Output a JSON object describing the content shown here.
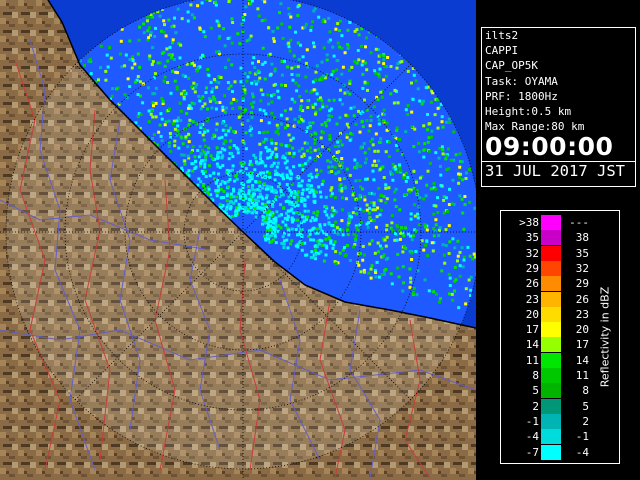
{
  "info_panel": {
    "lines": [
      "ilts2",
      "CAPPI",
      "CAP_OP5K",
      "Task: OYAMA",
      "PRF: 1800Hz",
      "Height:0.5 km",
      "Max Range:80 km"
    ],
    "time": "09:00:00",
    "date": "31 JUL 2017 JST"
  },
  "legend": {
    "title": "Reflectivity in dBZ",
    "rows": [
      {
        "low": ">38",
        "high": "---",
        "color": "#ff00ff"
      },
      {
        "low": "35",
        "high": "38",
        "color": "#c800c8"
      },
      {
        "low": "32",
        "high": "35",
        "color": "#ff0000"
      },
      {
        "low": "29",
        "high": "32",
        "color": "#ff4600"
      },
      {
        "low": "26",
        "high": "29",
        "color": "#ff8c00"
      },
      {
        "low": "23",
        "high": "26",
        "color": "#ffb400"
      },
      {
        "low": "20",
        "high": "23",
        "color": "#ffdc00"
      },
      {
        "low": "17",
        "high": "20",
        "color": "#ffff00"
      },
      {
        "low": "14",
        "high": "17",
        "color": "#96ff00"
      },
      {
        "low": "11",
        "high": "14",
        "color": "#00e600"
      },
      {
        "low": "8",
        "high": "11",
        "color": "#00c800"
      },
      {
        "low": "5",
        "high": "8",
        "color": "#00b400"
      },
      {
        "low": "2",
        "high": "5",
        "color": "#009678"
      },
      {
        "low": "-1",
        "high": "2",
        "color": "#00b4b4"
      },
      {
        "low": "-4",
        "high": "-1",
        "color": "#00dcdc"
      },
      {
        "low": "-7",
        "high": "-4",
        "color": "#00ffff"
      }
    ]
  },
  "map_colors": {
    "sea": "#0a3cd2",
    "radar_range": "#1e5aff",
    "land": "#8a6b45",
    "land_light": "#b49a72",
    "rivers": "#6060c8",
    "boundaries": "#c83c3c"
  }
}
